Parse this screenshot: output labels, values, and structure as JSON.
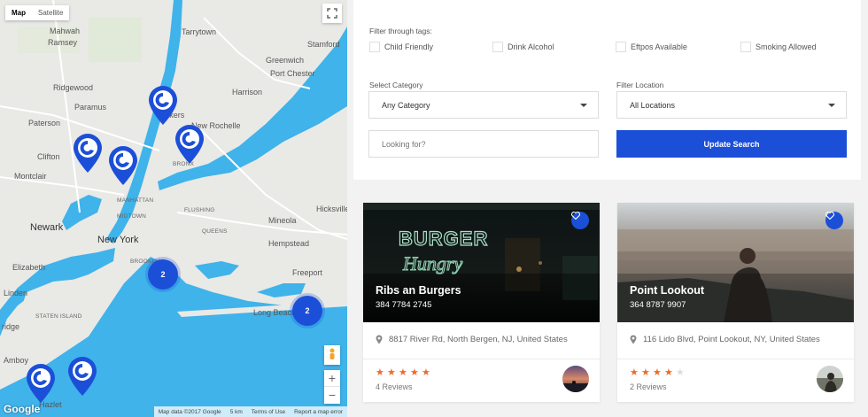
{
  "map": {
    "type_tabs": [
      "Map",
      "Satellite"
    ],
    "active_tab": "Map",
    "cities": [
      {
        "label": "Mahwah",
        "cls": ""
      },
      {
        "label": "Ramsey",
        "cls": ""
      },
      {
        "label": "Ridgewood",
        "cls": ""
      },
      {
        "label": "Paramus",
        "cls": ""
      },
      {
        "label": "Paterson",
        "cls": ""
      },
      {
        "label": "Clifton",
        "cls": ""
      },
      {
        "label": "Montclair",
        "cls": ""
      },
      {
        "label": "Newark",
        "cls": "big"
      },
      {
        "label": "Elizabeth",
        "cls": ""
      },
      {
        "label": "Linden",
        "cls": ""
      },
      {
        "label": "Tarrytown",
        "cls": ""
      },
      {
        "label": "Stamford",
        "cls": ""
      },
      {
        "label": "Greenwich",
        "cls": ""
      },
      {
        "label": "Port Chester",
        "cls": ""
      },
      {
        "label": "Harrison",
        "cls": ""
      },
      {
        "label": "Yonkers",
        "cls": ""
      },
      {
        "label": "New Rochelle",
        "cls": ""
      },
      {
        "label": "BRONX",
        "cls": "small"
      },
      {
        "label": "MANHATTAN",
        "cls": "small"
      },
      {
        "label": "MIDTOWN",
        "cls": "small"
      },
      {
        "label": "FLUSHING",
        "cls": "small"
      },
      {
        "label": "New York",
        "cls": "big"
      },
      {
        "label": "QUEENS",
        "cls": "small"
      },
      {
        "label": "BROOKLYN",
        "cls": "small"
      },
      {
        "label": "Mineola",
        "cls": ""
      },
      {
        "label": "Hicksville",
        "cls": ""
      },
      {
        "label": "Hempstead",
        "cls": ""
      },
      {
        "label": "Freeport",
        "cls": ""
      },
      {
        "label": "Long Beach",
        "cls": ""
      },
      {
        "label": "STATEN ISLAND",
        "cls": "small"
      },
      {
        "label": "ridge",
        "cls": ""
      },
      {
        "label": "Amboy",
        "cls": ""
      },
      {
        "label": "Hazlet",
        "cls": ""
      }
    ],
    "clusters": [
      "2",
      "2"
    ],
    "footer": [
      "Map data ©2017 Google",
      "5 km",
      "Terms of Use",
      "Report a map error"
    ],
    "google_logo": "Google"
  },
  "filters": {
    "tags_label": "Filter through tags:",
    "tags": [
      "Child Friendly",
      "Drink Alcohol",
      "Eftpos Available",
      "Smoking Allowed"
    ],
    "category_label": "Select Category",
    "category_value": "Any Category",
    "location_label": "Filter Location",
    "location_value": "All Locations",
    "search_placeholder": "Looking for?",
    "update_button": "Update Search"
  },
  "listings": [
    {
      "title": "Ribs an Burgers",
      "phone": "384 7784 2745",
      "address": "8817 River Rd, North Bergen, NJ, United States",
      "rating": 5,
      "reviews": "4 Reviews",
      "sign_text_1": "BURGER",
      "sign_text_2": "Hungry"
    },
    {
      "title": "Point Lookout",
      "phone": "364 8787 9907",
      "address": "116 Lido Blvd, Point Lookout, NY, United States",
      "rating": 4,
      "reviews": "2 Reviews"
    }
  ],
  "colors": {
    "accent": "#1c4fd8",
    "star": "#f06a2a",
    "water": "#3fb3ea"
  },
  "icons": {
    "favorite": "heart-icon",
    "address": "map-marker-icon",
    "star": "star-icon",
    "fullscreen": "fullscreen-icon",
    "pegman": "pegman-icon"
  }
}
